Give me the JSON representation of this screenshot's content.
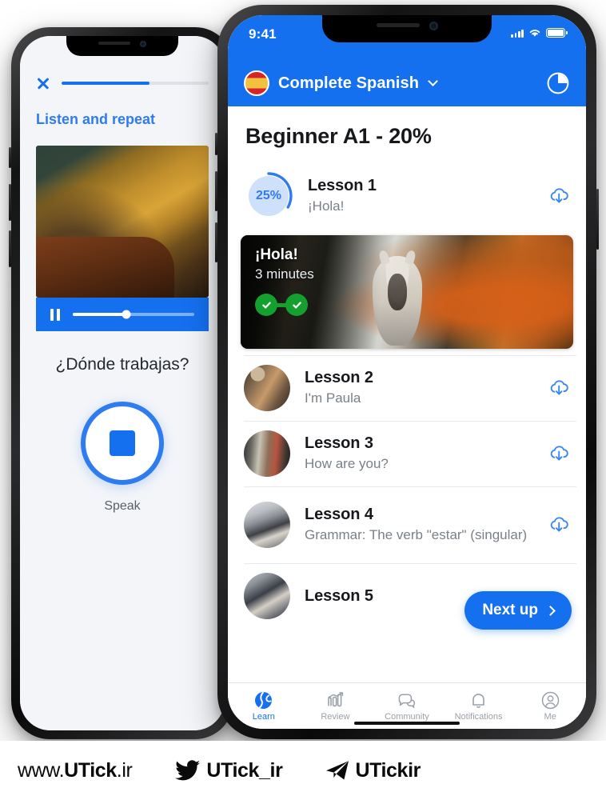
{
  "left_phone": {
    "close_icon": "close-x-icon",
    "progress_percent": 60,
    "heading": "Listen and repeat",
    "player": {
      "state_icon": "pause-icon",
      "scrub_percent": 44
    },
    "phrase": "¿Dónde trabajas?",
    "record": {
      "icon": "stop-square-icon",
      "label": "Speak"
    }
  },
  "right_phone": {
    "status_bar": {
      "time": "9:41",
      "signal_icon": "cellular-signal-icon",
      "wifi_icon": "wifi-icon",
      "battery_icon": "battery-full-icon"
    },
    "appbar": {
      "flag_icon": "spain-flag-icon",
      "title": "Complete Spanish",
      "chevron_icon": "chevron-down-icon",
      "timer_icon": "clock-timer-icon"
    },
    "course_title": "Beginner A1 - 20%",
    "lessons": [
      {
        "id": "lesson-1",
        "title": "Lesson 1",
        "subtitle": "¡Hola!",
        "progress": "25%",
        "progress_value": 25,
        "download_icon": "cloud-download-icon",
        "thumb_type": "progress-ring"
      },
      {
        "id": "lesson-2",
        "title": "Lesson 2",
        "subtitle": "I'm Paula",
        "download_icon": "cloud-download-icon",
        "thumb_type": "photo"
      },
      {
        "id": "lesson-3",
        "title": "Lesson 3",
        "subtitle": "How are you?",
        "download_icon": "cloud-download-icon",
        "thumb_type": "photo"
      },
      {
        "id": "lesson-4",
        "title": "Lesson 4",
        "subtitle": "Grammar: The verb \"estar\" (singular)",
        "download_icon": "cloud-download-icon",
        "thumb_type": "photo"
      },
      {
        "id": "lesson-5",
        "title": "Lesson 5",
        "subtitle": "",
        "thumb_type": "photo"
      }
    ],
    "video_card": {
      "title": "¡Hola!",
      "duration": "3 minutes",
      "check_icons": [
        "check-circle-icon",
        "check-circle-icon"
      ]
    },
    "next_up": {
      "label": "Next up",
      "chevron_icon": "chevron-right-icon"
    },
    "tabs": [
      {
        "label": "Learn",
        "icon": "globe-icon",
        "active": true
      },
      {
        "label": "Review",
        "icon": "bar-chart-icon",
        "active": false
      },
      {
        "label": "Community",
        "icon": "chat-bubbles-icon",
        "active": false
      },
      {
        "label": "Notifications",
        "icon": "bell-icon",
        "active": false
      },
      {
        "label": "Me",
        "icon": "person-circle-icon",
        "active": false
      }
    ]
  },
  "footer": {
    "website": {
      "prefix": "www.",
      "name": "UTick",
      "suffix": ".ir"
    },
    "twitter": {
      "icon": "twitter-bird-icon",
      "handle": "UTick_ir"
    },
    "telegram": {
      "icon": "telegram-plane-icon",
      "handle": "UTickir"
    }
  },
  "colors": {
    "brand_blue": "#1570f0",
    "accent_blue": "#2f7bf0",
    "success_green": "#14a02e",
    "text_primary": "#16181c",
    "text_secondary": "#7a8089"
  }
}
